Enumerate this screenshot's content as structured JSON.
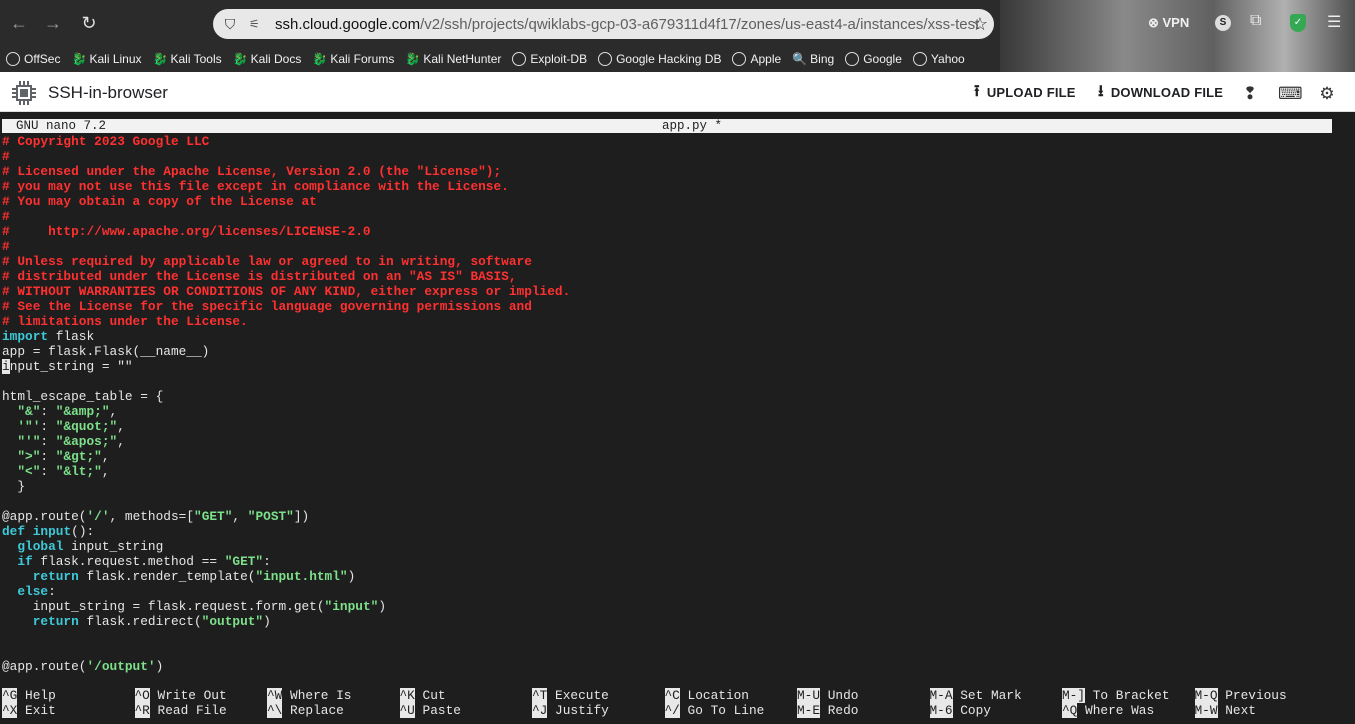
{
  "browser": {
    "url_host": "ssh.cloud.google.com",
    "url_path": "/v2/ssh/projects/qwiklabs-gcp-03-a679311d4f17/zones/us-east4-a/instances/xss-test",
    "vpn_label": "VPN",
    "profile_initial": "S",
    "bookmarks": [
      "OffSec",
      "Kali Linux",
      "Kali Tools",
      "Kali Docs",
      "Kali Forums",
      "Kali NetHunter",
      "Exploit-DB",
      "Google Hacking DB",
      "Apple",
      "Bing",
      "Google",
      "Yahoo"
    ]
  },
  "app": {
    "title": "SSH-in-browser",
    "upload_label": "UPLOAD FILE",
    "download_label": "DOWNLOAD FILE"
  },
  "nano": {
    "version": "GNU nano 7.2",
    "filename": "app.py *",
    "lines": [
      [
        [
          "c",
          "# Copyright 2023 Google LLC"
        ]
      ],
      [
        [
          "c",
          "#"
        ]
      ],
      [
        [
          "c",
          "# Licensed under the Apache License, Version 2.0 (the \"License\");"
        ]
      ],
      [
        [
          "c",
          "# you may not use this file except in compliance with the License."
        ]
      ],
      [
        [
          "c",
          "# You may obtain a copy of the License at"
        ]
      ],
      [
        [
          "c",
          "#"
        ]
      ],
      [
        [
          "c",
          "#     http://www.apache.org/licenses/LICENSE-2.0"
        ]
      ],
      [
        [
          "c",
          "#"
        ]
      ],
      [
        [
          "c",
          "# Unless required by applicable law or agreed to in writing, software"
        ]
      ],
      [
        [
          "c",
          "# distributed under the License is distributed on an \"AS IS\" BASIS,"
        ]
      ],
      [
        [
          "c",
          "# WITHOUT WARRANTIES OR CONDITIONS OF ANY KIND, either express or implied."
        ]
      ],
      [
        [
          "c",
          "# See the License for the specific language governing permissions and"
        ]
      ],
      [
        [
          "c",
          "# limitations under the License."
        ]
      ],
      [
        [
          "k",
          "import"
        ],
        [
          "n",
          " flask"
        ]
      ],
      [
        [
          "n",
          "app = flask.Flask(__name__)"
        ]
      ],
      [
        [
          "cur",
          "i"
        ],
        [
          "n",
          "nput_string = \"\""
        ]
      ],
      [],
      [
        [
          "n",
          "html_escape_table = {"
        ]
      ],
      [
        [
          "n",
          "  "
        ],
        [
          "s",
          "\"&\""
        ],
        [
          "n",
          ": "
        ],
        [
          "s",
          "\"&amp;\""
        ],
        [
          "n",
          ","
        ]
      ],
      [
        [
          "n",
          "  "
        ],
        [
          "s",
          "'\"'"
        ],
        [
          "n",
          ": "
        ],
        [
          "s",
          "\"&quot;\""
        ],
        [
          "n",
          ","
        ]
      ],
      [
        [
          "n",
          "  "
        ],
        [
          "s",
          "\"'\""
        ],
        [
          "n",
          ": "
        ],
        [
          "s",
          "\"&apos;\""
        ],
        [
          "n",
          ","
        ]
      ],
      [
        [
          "n",
          "  "
        ],
        [
          "s",
          "\">\""
        ],
        [
          "n",
          ": "
        ],
        [
          "s",
          "\"&gt;\""
        ],
        [
          "n",
          ","
        ]
      ],
      [
        [
          "n",
          "  "
        ],
        [
          "s",
          "\"<\""
        ],
        [
          "n",
          ": "
        ],
        [
          "s",
          "\"&lt;\""
        ],
        [
          "n",
          ","
        ]
      ],
      [
        [
          "n",
          "  }"
        ]
      ],
      [],
      [
        [
          "n",
          "@app.route("
        ],
        [
          "s",
          "'/'"
        ],
        [
          "n",
          ", methods=["
        ],
        [
          "s",
          "\"GET\""
        ],
        [
          "n",
          ", "
        ],
        [
          "s",
          "\"POST\""
        ],
        [
          "n",
          "])"
        ]
      ],
      [
        [
          "k",
          "def"
        ],
        [
          "n",
          " "
        ],
        [
          "k",
          "input"
        ],
        [
          "n",
          "():"
        ]
      ],
      [
        [
          "n",
          "  "
        ],
        [
          "k",
          "global"
        ],
        [
          "n",
          " input_string"
        ]
      ],
      [
        [
          "n",
          "  "
        ],
        [
          "k",
          "if"
        ],
        [
          "n",
          " flask.request.method == "
        ],
        [
          "s",
          "\"GET\""
        ],
        [
          "n",
          ":"
        ]
      ],
      [
        [
          "n",
          "    "
        ],
        [
          "k",
          "return"
        ],
        [
          "n",
          " flask.render_template("
        ],
        [
          "s",
          "\"input.html\""
        ],
        [
          "n",
          ")"
        ]
      ],
      [
        [
          "n",
          "  "
        ],
        [
          "k",
          "else"
        ],
        [
          "n",
          ":"
        ]
      ],
      [
        [
          "n",
          "    input_string = flask.request.form.get("
        ],
        [
          "s",
          "\"input\""
        ],
        [
          "n",
          ")"
        ]
      ],
      [
        [
          "n",
          "    "
        ],
        [
          "k",
          "return"
        ],
        [
          "n",
          " flask.redirect("
        ],
        [
          "s",
          "\"output\""
        ],
        [
          "n",
          ")"
        ]
      ],
      [],
      [],
      [
        [
          "n",
          "@app.route("
        ],
        [
          "s",
          "'/output'"
        ],
        [
          "n",
          ")"
        ]
      ]
    ],
    "shortcuts": [
      [
        {
          "key": "^G",
          "label": "Help"
        },
        {
          "key": "^X",
          "label": "Exit"
        }
      ],
      [
        {
          "key": "^O",
          "label": "Write Out"
        },
        {
          "key": "^R",
          "label": "Read File"
        }
      ],
      [
        {
          "key": "^W",
          "label": "Where Is"
        },
        {
          "key": "^\\",
          "label": "Replace"
        }
      ],
      [
        {
          "key": "^K",
          "label": "Cut"
        },
        {
          "key": "^U",
          "label": "Paste"
        }
      ],
      [
        {
          "key": "^T",
          "label": "Execute"
        },
        {
          "key": "^J",
          "label": "Justify"
        }
      ],
      [
        {
          "key": "^C",
          "label": "Location"
        },
        {
          "key": "^/",
          "label": "Go To Line"
        }
      ],
      [
        {
          "key": "M-U",
          "label": "Undo"
        },
        {
          "key": "M-E",
          "label": "Redo"
        }
      ],
      [
        {
          "key": "M-A",
          "label": "Set Mark"
        },
        {
          "key": "M-6",
          "label": "Copy"
        }
      ],
      [
        {
          "key": "M-]",
          "label": "To Bracket"
        },
        {
          "key": "^Q",
          "label": "Where Was"
        }
      ],
      [
        {
          "key": "M-Q",
          "label": "Previous"
        },
        {
          "key": "M-W",
          "label": "Next"
        }
      ]
    ]
  }
}
